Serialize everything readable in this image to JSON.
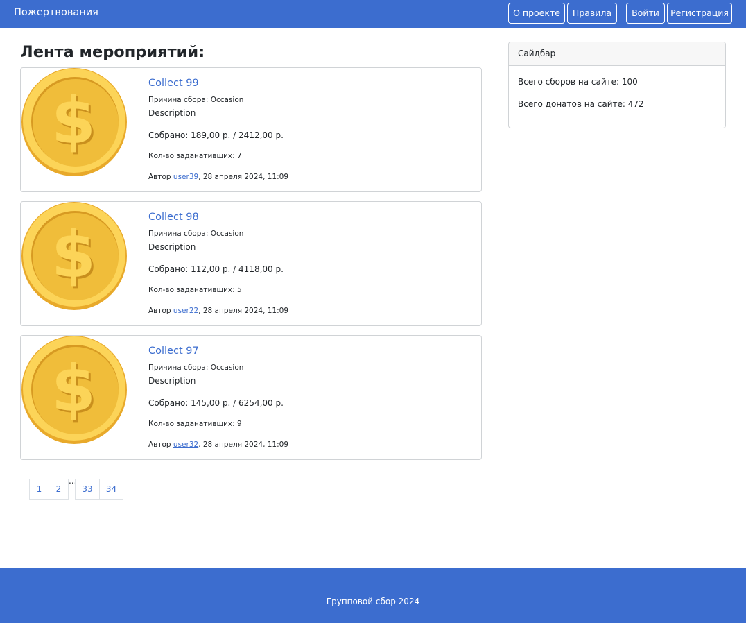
{
  "navbar": {
    "brand": "Пожертвования",
    "about_label": "О проекте",
    "rules_label": "Правила",
    "login_label": "Войти",
    "register_label": "Регистрация"
  },
  "page_title": "Лента мероприятий:",
  "collections": [
    {
      "title": "Collect 99",
      "reason": "Причина сбора: Occasion",
      "description": "Description",
      "collected": "Собрано: 189,00 р. / 2412,00 р.",
      "donors": "Кол-во заданативших: 7",
      "author_prefix": "Автор ",
      "author_name": "user39",
      "date": ", 28 апреля 2024, 11:09"
    },
    {
      "title": "Collect 98",
      "reason": "Причина сбора: Occasion",
      "description": "Description",
      "collected": "Собрано: 112,00 р. / 4118,00 р.",
      "donors": "Кол-во заданативших: 5",
      "author_prefix": "Автор ",
      "author_name": "user22",
      "date": ", 28 апреля 2024, 11:09"
    },
    {
      "title": "Collect 97",
      "reason": "Причина сбора: Occasion",
      "description": "Description",
      "collected": "Собрано: 145,00 р. / 6254,00 р.",
      "donors": "Кол-во заданативших: 9",
      "author_prefix": "Автор ",
      "author_name": "user32",
      "date": ", 28 апреля 2024, 11:09"
    }
  ],
  "pagination": {
    "pages": [
      "1",
      "2",
      "33",
      "34"
    ],
    "ellipsis": "..."
  },
  "sidebar": {
    "title": "Сайдбар",
    "total_collections": "Всего сборов на сайте: 100",
    "total_donations": "Всего донатов на сайте: 472"
  },
  "footer": {
    "text": "Групповой сбор 2024"
  },
  "colors": {
    "primary": "#3c6dcf",
    "coin_gold": "#f0bd3a",
    "coin_rim": "#fcd458"
  },
  "icons": {
    "coin": "dollar-coin-icon"
  }
}
